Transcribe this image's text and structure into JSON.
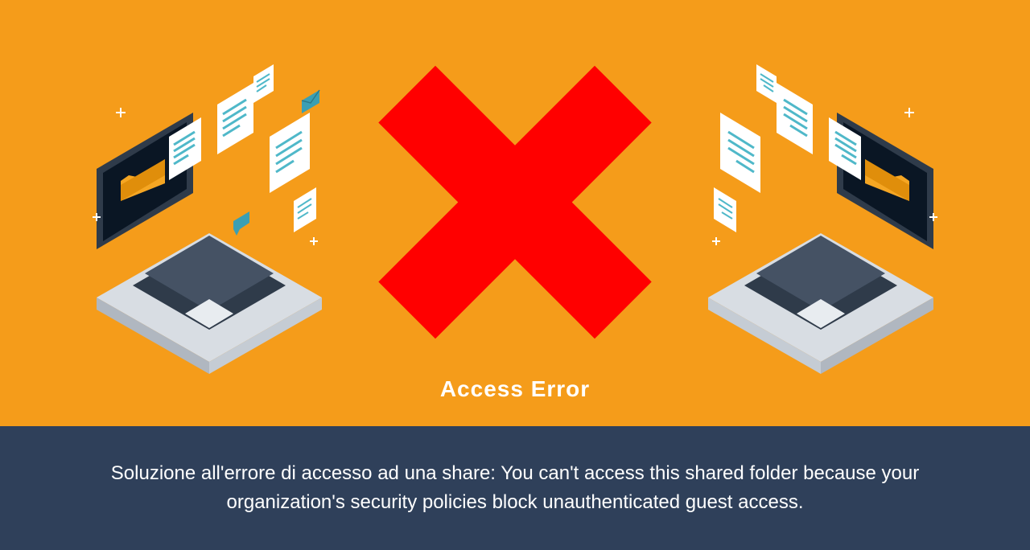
{
  "hero": {
    "title": "Access Error"
  },
  "caption": {
    "text": "Soluzione all'errore di accesso ad una share: You can't access this shared folder because your organization's security policies block unauthenticated guest access."
  },
  "colors": {
    "heroBg": "#f59c1a",
    "captionBg": "#2f405a",
    "crossColor": "#ff0000"
  }
}
